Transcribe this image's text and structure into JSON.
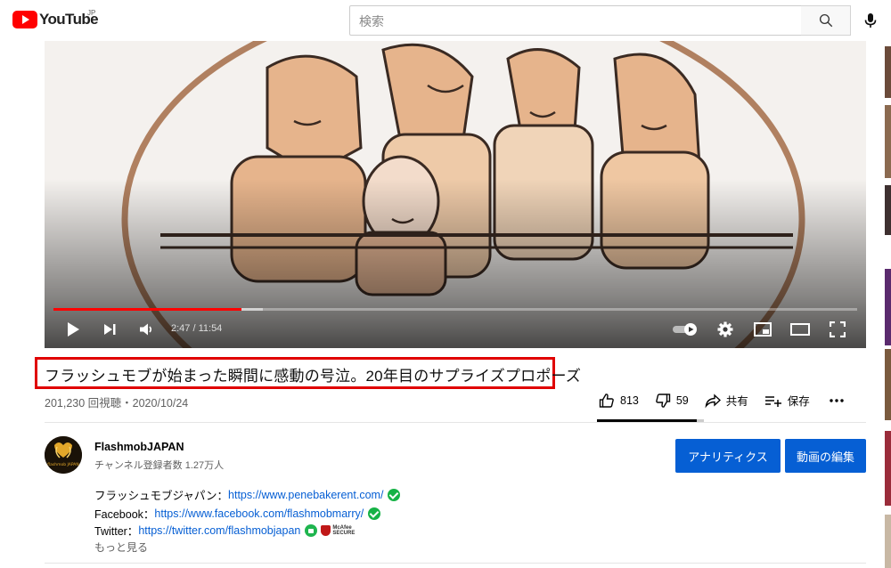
{
  "header": {
    "logo_text": "YouTube",
    "region": "JP",
    "search_placeholder": "検索"
  },
  "player": {
    "time_current": "2:47",
    "time_total": "11:54",
    "progress_fraction": 0.234
  },
  "video": {
    "title": "フラッシュモブが始まった瞬間に感動の号泣。20年目のサプライズプロポーズ",
    "meta": "201,230 回視聴・2020/10/24",
    "likes": "813",
    "dislikes": "59",
    "share_label": "共有",
    "save_label": "保存",
    "like_fraction": 0.93
  },
  "channel": {
    "name": "FlashmobJAPAN",
    "subscribers": "チャンネル登録者数 1.27万人",
    "avatar_text": "flashmob JAPAN",
    "analytics_label": "アナリティクス",
    "edit_label": "動画の編集"
  },
  "description": {
    "line1_prefix": "フラッシュモブジャパン：",
    "line1_link": "https://www.penebakerent.com/",
    "line2_prefix": "Facebook：",
    "line2_link": "https://www.facebook.com/flashmobmarry/",
    "line3_prefix": "Twitter：",
    "line3_link": "https://twitter.com/flashmobjapan",
    "mcafee_line1": "McAfee",
    "mcafee_line2": "SECURE",
    "more_label": "もっと見る"
  },
  "colors": {
    "brand_red": "#ff0000",
    "highlight_red": "#e00000",
    "button_blue": "#065fd4",
    "link_blue": "#065fd4",
    "verified_green": "#16b246"
  }
}
